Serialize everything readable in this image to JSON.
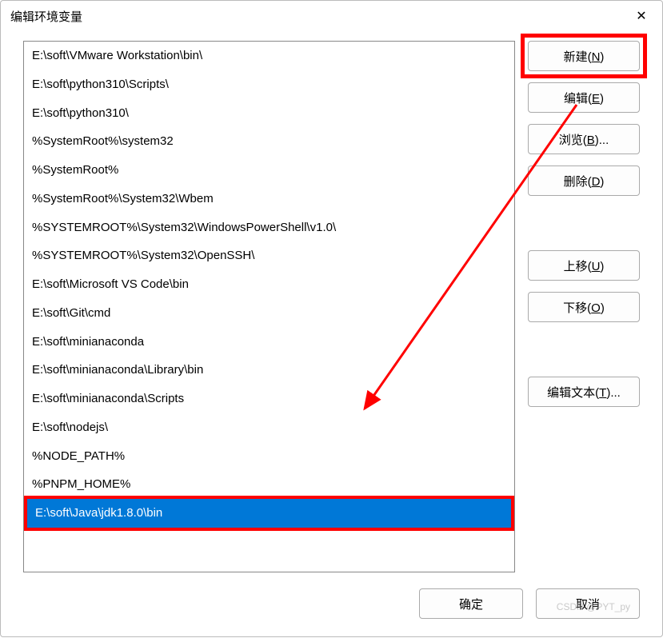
{
  "dialog": {
    "title": "编辑环境变量"
  },
  "list": {
    "items": [
      "E:\\soft\\VMware Workstation\\bin\\",
      "E:\\soft\\python310\\Scripts\\",
      "E:\\soft\\python310\\",
      "%SystemRoot%\\system32",
      "%SystemRoot%",
      "%SystemRoot%\\System32\\Wbem",
      "%SYSTEMROOT%\\System32\\WindowsPowerShell\\v1.0\\",
      "%SYSTEMROOT%\\System32\\OpenSSH\\",
      "E:\\soft\\Microsoft VS Code\\bin",
      "E:\\soft\\Git\\cmd",
      "E:\\soft\\minianaconda",
      "E:\\soft\\minianaconda\\Library\\bin",
      "E:\\soft\\minianaconda\\Scripts",
      "E:\\soft\\nodejs\\",
      "%NODE_PATH%",
      "%PNPM_HOME%"
    ],
    "selected": "E:\\soft\\Java\\jdk1.8.0\\bin"
  },
  "buttons": {
    "new": "新建(N)",
    "edit": "编辑(E)",
    "browse": "浏览(B)...",
    "delete": "删除(D)",
    "up": "上移(U)",
    "down": "下移(O)",
    "edittext": "编辑文本(T)...",
    "ok": "确定",
    "cancel": "取消"
  },
  "annotation": {
    "highlight_color": "#ff0000"
  },
  "watermark": "CSDN @PYT_py"
}
